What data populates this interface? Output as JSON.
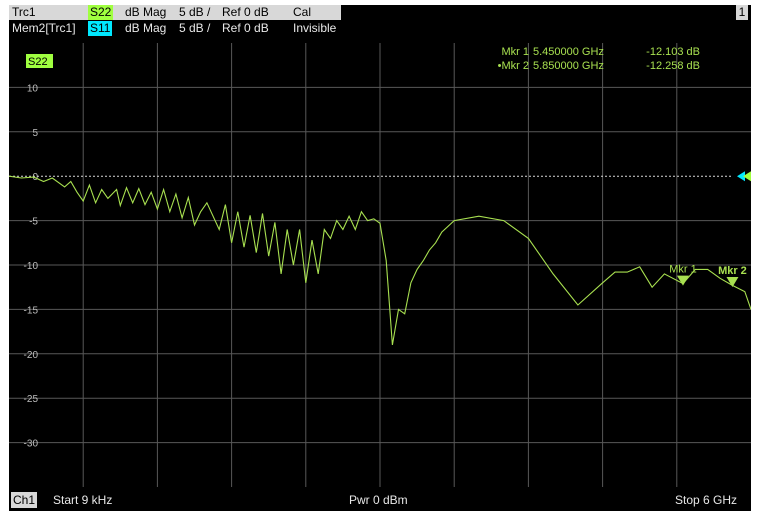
{
  "header": {
    "row1": {
      "trace": "Trc1",
      "param": "S22",
      "format": "dB Mag",
      "scale": "5 dB /",
      "ref": "Ref 0 dB",
      "state": "Cal"
    },
    "row2": {
      "trace": "Mem2[Trc1]",
      "param": "S11",
      "format": "dB Mag",
      "scale": "5 dB /",
      "ref": "Ref 0 dB",
      "state": "Invisible"
    },
    "channel_number": "1"
  },
  "colors": {
    "trace": "#a8e050",
    "s22_tag": "#a0ff40",
    "s11_tag": "#00e8ff",
    "grid": "#585858",
    "background": "#000000"
  },
  "footer": {
    "channel": "Ch1",
    "start": "Start  9 kHz",
    "power": "Pwr  0 dBm",
    "stop": "Stop  6 GHz"
  },
  "chart_data": {
    "type": "line",
    "trace_label": "S22",
    "xlim": [
      9e-06,
      6.0
    ],
    "ylim": [
      -35,
      15
    ],
    "yticks": [
      10,
      5,
      0,
      -5,
      -10,
      -15,
      -20,
      -25,
      -30
    ],
    "ytick_labels": [
      "10",
      "5",
      "0",
      "-5",
      "-10",
      "-15",
      "-20",
      "-25",
      "-30"
    ],
    "grid": true,
    "reference_level": 0,
    "series": [
      {
        "x": [
          0.0,
          0.1,
          0.2,
          0.28,
          0.35,
          0.45,
          0.5,
          0.55,
          0.6,
          0.65,
          0.7,
          0.75,
          0.8,
          0.87,
          0.9,
          0.95,
          1.0,
          1.05,
          1.1,
          1.15,
          1.2,
          1.25,
          1.3,
          1.35,
          1.4,
          1.45,
          1.5,
          1.55,
          1.6,
          1.7,
          1.75,
          1.8,
          1.85,
          1.9,
          1.95,
          2.0,
          2.05,
          2.1,
          2.15,
          2.2,
          2.25,
          2.3,
          2.35,
          2.4,
          2.45,
          2.5,
          2.55,
          2.6,
          2.65,
          2.7,
          2.75,
          2.8,
          2.85,
          2.9,
          2.95,
          3.0,
          3.05,
          3.1,
          3.15,
          3.2,
          3.25,
          3.3,
          3.35,
          3.4,
          3.45,
          3.5,
          3.6,
          3.8,
          4.0,
          4.2,
          4.4,
          4.6,
          4.8,
          4.9,
          5.0,
          5.1,
          5.2,
          5.3,
          5.45,
          5.55,
          5.65,
          5.75,
          5.85,
          5.95,
          6.0
        ],
        "y": [
          0.0,
          -0.2,
          -0.1,
          -0.6,
          -0.2,
          -1.2,
          -0.6,
          -1.8,
          -2.8,
          -1.0,
          -3.0,
          -1.5,
          -2.5,
          -1.5,
          -3.3,
          -1.3,
          -3.0,
          -1.4,
          -3.2,
          -1.8,
          -3.7,
          -1.5,
          -4.0,
          -2.0,
          -4.7,
          -2.4,
          -5.5,
          -4.0,
          -3.0,
          -6.0,
          -3.2,
          -7.5,
          -4.0,
          -8.0,
          -4.4,
          -8.6,
          -4.2,
          -9.0,
          -5.2,
          -11.0,
          -6.0,
          -10.0,
          -6.0,
          -12.0,
          -7.2,
          -11.0,
          -6.0,
          -7.0,
          -5.0,
          -6.0,
          -4.5,
          -6.0,
          -4.0,
          -5.0,
          -4.8,
          -5.3,
          -9.5,
          -19.0,
          -15.0,
          -15.5,
          -12.0,
          -10.5,
          -9.5,
          -8.3,
          -7.5,
          -6.3,
          -5.0,
          -4.5,
          -5.0,
          -7.0,
          -11.0,
          -14.5,
          -12.0,
          -10.8,
          -10.8,
          -10.2,
          -12.5,
          -11.0,
          -12.1,
          -10.5,
          -10.5,
          -11.5,
          -12.3,
          -13.0,
          -15.0
        ]
      }
    ],
    "markers": [
      {
        "label": "Mkr 1",
        "freq": "5.450000 GHz",
        "value": "-12.103 dB",
        "x": 5.45,
        "y": -12.103,
        "active": false
      },
      {
        "label": "Mkr 2",
        "freq": "5.850000 GHz",
        "value": "-12.258 dB",
        "x": 5.85,
        "y": -12.258,
        "active": true
      }
    ]
  }
}
